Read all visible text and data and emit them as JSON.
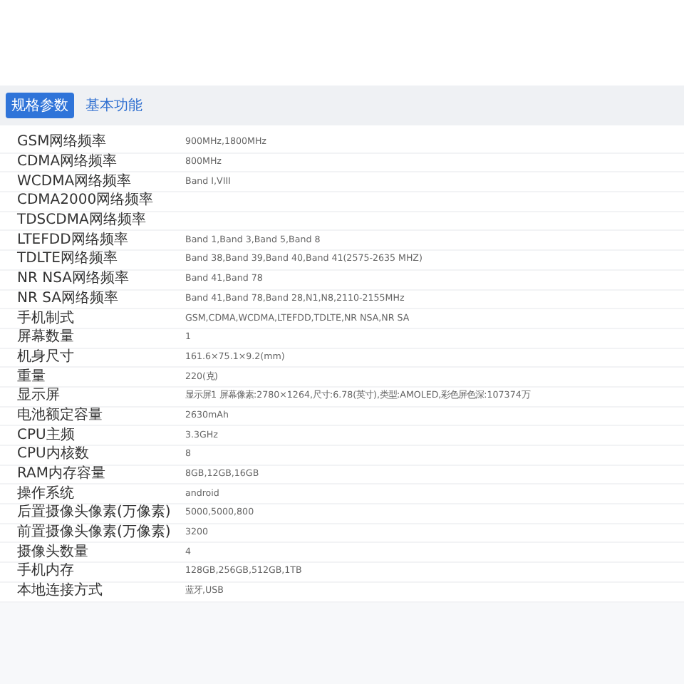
{
  "tabs": [
    {
      "label": "规格参数",
      "selected": true
    },
    {
      "label": "基本功能",
      "selected": false
    }
  ],
  "specs": [
    {
      "name": "GSM网络频率",
      "value": "900MHz,1800MHz"
    },
    {
      "name": "CDMA网络频率",
      "value": "800MHz"
    },
    {
      "name": "WCDMA网络频率",
      "value": "Band I,VIII"
    },
    {
      "name": "CDMA2000网络频率"
    },
    {
      "name": "TDSCDMA网络频率"
    },
    {
      "name": "LTEFDD网络频率",
      "value": "Band 1,Band 3,Band 5,Band 8"
    },
    {
      "name": "TDLTE网络频率",
      "value": "Band 38,Band 39,Band 40,Band 41(2575-2635 MHZ)"
    },
    {
      "name": "NR NSA网络频率",
      "value": "Band 41,Band 78"
    },
    {
      "name": "NR SA网络频率",
      "value": "Band 41,Band 78,Band 28,N1,N8,2110-2155MHz"
    },
    {
      "name": "手机制式",
      "value": "GSM,CDMA,WCDMA,LTEFDD,TDLTE,NR NSA,NR SA"
    },
    {
      "name": "屏幕数量",
      "value": "1"
    },
    {
      "name": "机身尺寸",
      "value": "161.6×75.1×9.2(mm)"
    },
    {
      "name": "重量",
      "value": "220(克)"
    },
    {
      "name": "显示屏",
      "value": "显示屏1 屏幕像素:2780×1264,尺寸:6.78(英寸),类型:AMOLED,彩色屏色深:107374万"
    },
    {
      "name": "电池额定容量",
      "value": "2630mAh"
    },
    {
      "name": "CPU主频",
      "value": "3.3GHz"
    },
    {
      "name": "CPU内核数",
      "value": "8"
    },
    {
      "name": "RAM内存容量",
      "value": "8GB,12GB,16GB"
    },
    {
      "name": "操作系统",
      "value": "android"
    },
    {
      "name": "后置摄像头像素(万像素)",
      "value": "5000,5000,800"
    },
    {
      "name": "前置摄像头像素(万像素)",
      "value": "3200"
    },
    {
      "name": "摄像头数量",
      "value": "4"
    },
    {
      "name": "手机内存",
      "value": "128GB,256GB,512GB,1TB"
    },
    {
      "name": "本地连接方式",
      "value": "蓝牙,USB"
    }
  ]
}
